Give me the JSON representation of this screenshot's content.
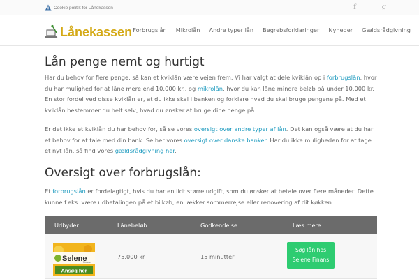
{
  "topbar": {
    "cookie_text": "Cookie politik for Lånekassen",
    "social": {
      "facebook_glyph": "f",
      "google_glyph": "g"
    }
  },
  "header": {
    "logo_text": "Lånekassen",
    "nav": [
      "Forbrugslån",
      "Mikrolån",
      "Andre typer lån",
      "Begrebsforklaringer",
      "Nyheder",
      "Gældsrådgivning"
    ]
  },
  "main": {
    "title": "Lån penge nemt og hurtigt",
    "p1": {
      "t1": "Har du behov for flere penge, så kan et kviklån være vejen frem. Vi har valgt at dele kviklån op i ",
      "l1": "forbrugslån",
      "t2": ", hvor du har mulighed for at låne mere end 10.000 kr., og ",
      "l2": "mikrolån",
      "t3": ", hvor du kan låne mindre beløb på under 10.000 kr. En stor fordel ved disse kviklån er, at du ikke skal i banken og forklare hvad du skal bruge pengene på. Med et kviklån bestemmer du helt selv, hvad du ønsker at bruge dine penge på."
    },
    "p2": {
      "t1": "Er det ikke et kviklån du har behov for, så se vores ",
      "l1": "oversigt over andre typer af lån",
      "t2": ". Det kan også være at du har et behov for at tale med din bank. Se her vores ",
      "l2": "oversigt over danske banker",
      "t3": ". Har du ikke muligheden for at tage et nyt lån, så find vores ",
      "l3": "gældsrådgivning her",
      "t4": "."
    },
    "subtitle": "Oversigt over forbrugslån:",
    "p3": {
      "t1": "Et ",
      "l1": "forbrugslån",
      "t2": " er fordelagtigt, hvis du har en lidt større udgift, som du ønsker at betale over flere måneder. Dette kunne f.eks. være udbetalingen på et bilkøb, en lækker sommerrejse eller renovering af dit køkken."
    }
  },
  "table": {
    "headers": [
      "Udbyder",
      "Lånebeløb",
      "Godkendelse",
      "Læs mere"
    ],
    "rows": [
      {
        "provider_logo_text": "Selene",
        "provider_logo_sub": "Finans",
        "provider_logo_cta": "Ansøg her",
        "amount": "75.000 kr",
        "approval": "15 minutter",
        "button": "Søg lån hos Selene Finans"
      }
    ]
  },
  "colors": {
    "accent_link": "#1f9bbf",
    "logo": "#d4a915",
    "cta": "#2ecc71",
    "table_header": "#6b6b6b"
  }
}
